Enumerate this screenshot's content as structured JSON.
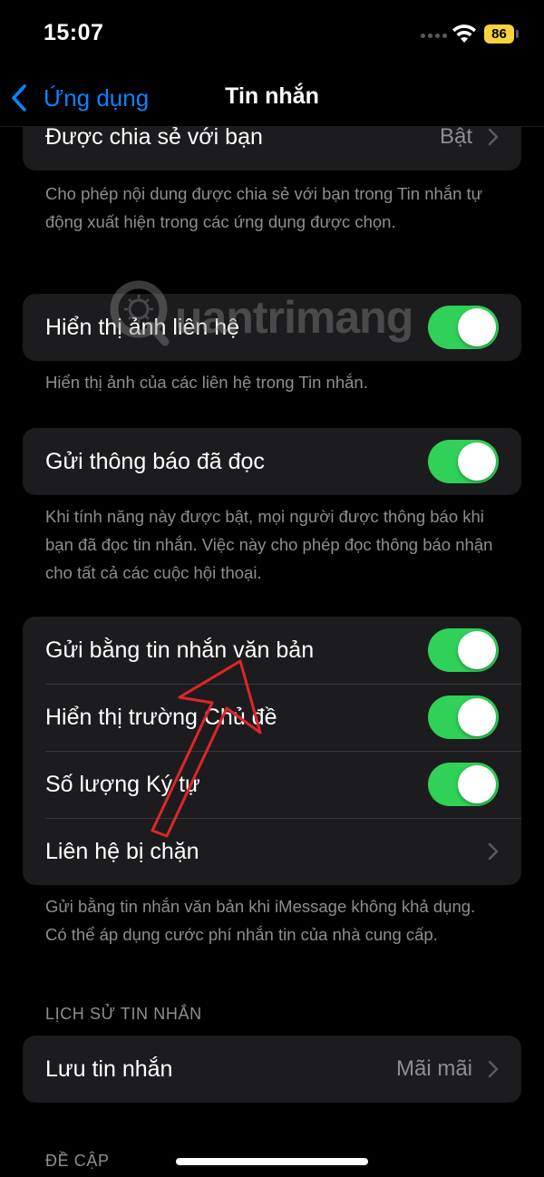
{
  "status_bar": {
    "time": "15:07",
    "battery": "86",
    "battery_color": "#f5d33b"
  },
  "nav": {
    "back_label": "Ứng dụng",
    "title": "Tin nhắn",
    "accent_color": "#0a84ff"
  },
  "shared_with_you": {
    "label": "Được chia sẻ với bạn",
    "value": "Bật",
    "footnote": "Cho phép nội dung được chia sẻ với bạn trong Tin nhắn tự động xuất hiện trong các ứng dụng được chọn."
  },
  "show_contact_photos": {
    "label": "Hiển thị ảnh liên hệ",
    "enabled": true,
    "footnote": "Hiển thị ảnh của các liên hệ trong Tin nhắn."
  },
  "read_receipts": {
    "label": "Gửi thông báo đã đọc",
    "enabled": true,
    "footnote": "Khi tính năng này được bật, mọi người được thông báo khi bạn đã đọc tin nhắn. Việc này cho phép đọc thông báo nhận cho tất cả các cuộc hội thoại."
  },
  "sms_group": {
    "rows": [
      {
        "label": "Gửi bằng tin nhắn văn bản",
        "enabled": true
      },
      {
        "label": "Hiển thị trường Chủ đề",
        "enabled": true
      },
      {
        "label": "Số lượng Ký tự",
        "enabled": true
      },
      {
        "label": "Liên hệ bị chặn"
      }
    ],
    "footnote": "Gửi bằng tin nhắn văn bản khi iMessage không khả dụng. Có thể áp dụng cước phí nhắn tin của nhà cung cấp."
  },
  "message_history": {
    "header": "LỊCH SỬ TIN NHẮN",
    "keep_messages_label": "Lưu tin nhắn",
    "keep_messages_value": "Mãi mãi"
  },
  "mentions": {
    "header": "ĐỀ CẬP"
  },
  "watermark": {
    "text": "uantrimang"
  },
  "colors": {
    "toggle_on": "#30d158",
    "card_bg": "#1c1c1e",
    "secondary_text": "#8e8e93",
    "annotation_arrow": "#e0252b"
  }
}
